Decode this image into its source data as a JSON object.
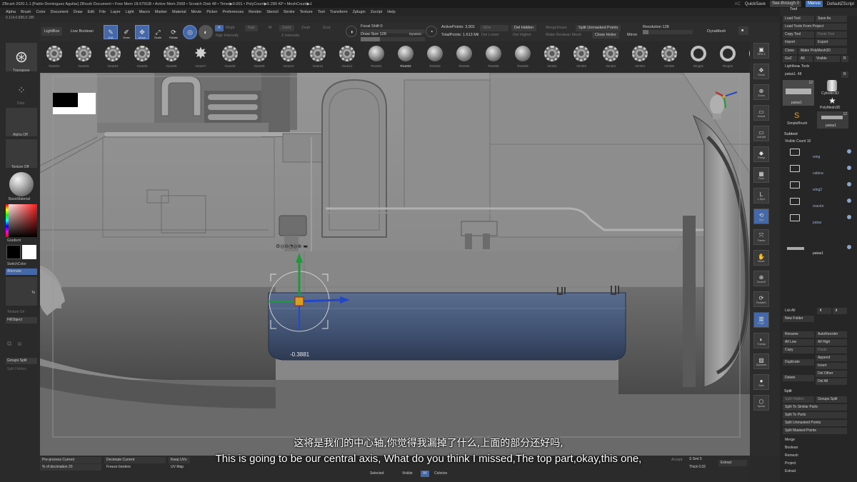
{
  "titlebar": {
    "text": "ZBrush 2020.1.1 [Pablo Dominguez Aguilar]   ZBrush Document     • Free Mem 18.675GB • Active Mem 2568 • Scratch Disk 48 •  Timer▶0.001 • PolyCount▶5.289 KP • MeshCount▶1",
    "ac": "AC",
    "quicksave": "QuickSave",
    "see_through": "See-through  0",
    "menus": "Menus",
    "script": "DefaultZScript"
  },
  "menubar": [
    "Alpha",
    "Brush",
    "Color",
    "Document",
    "Draw",
    "Edit",
    "File",
    "Layer",
    "Light",
    "Macro",
    "Marker",
    "Material",
    "Movie",
    "Picker",
    "Preferences",
    "Render",
    "Stencil",
    "Stroke",
    "Texture",
    "Tool",
    "Transform",
    "Zplugin",
    "Zscript",
    "Help"
  ],
  "coords": "0.114,0.836,0.185",
  "topbar": {
    "lightbox": "LightBox",
    "live_boolean": "Live Boolean",
    "edit": "Edit",
    "draw": "Draw",
    "move": "Move",
    "scale": "Scale",
    "rotate": "Rotate",
    "a": "A",
    "mrgb": "Mrgb",
    "rgb": "Rgb",
    "m": "M",
    "zadd": "Zadd",
    "zsub": "Zsub",
    "zcut": "Zcut",
    "rgb_intensity": "Rgb Intensity",
    "z_intensity": "Z Intensity",
    "focal_shift": "Focal Shift 0",
    "draw_size": "Draw Size 128",
    "dynamic": "Dynamic",
    "s": "S",
    "d": "D",
    "active_points": "ActivePoints: 3,901",
    "total_points": "TotalPoints: 1.613 Mil",
    "sdiv": "SDiv",
    "del_lower": "Del Lower",
    "del_hidden": "Del Hidden",
    "del_higher": "Del Higher",
    "merge_down": "MergeDown",
    "make_boolean_mesh": "Make Boolean Mesh",
    "split_unmasked": "Split Unmasked Points",
    "close_holes": "Close Holes",
    "mirror": "Mirror",
    "resolution": "Resolution 128",
    "dynamesh": "DynaMesh"
  },
  "brushes": [
    {
      "name": "Rivet01",
      "shape": "gear"
    },
    {
      "name": "Gear03",
      "shape": "gear"
    },
    {
      "name": "Gear04",
      "shape": "gear"
    },
    {
      "name": "Gear05",
      "shape": "gear"
    },
    {
      "name": "Gear06",
      "shape": "gear"
    },
    {
      "name": "Gear07",
      "shape": "star"
    },
    {
      "name": "Gear08",
      "shape": "gear"
    },
    {
      "name": "Gear09",
      "shape": "gear"
    },
    {
      "name": "Gear10",
      "shape": "gear"
    },
    {
      "name": "Gear11",
      "shape": "gear"
    },
    {
      "name": "Gear12",
      "shape": "gear"
    },
    {
      "name": "Rivet01",
      "shape": "ball"
    },
    {
      "name": "Rivet02",
      "shape": "ball",
      "selected": true
    },
    {
      "name": "Rivet03",
      "shape": "ball"
    },
    {
      "name": "Rivet04",
      "shape": "ball"
    },
    {
      "name": "Rivet05",
      "shape": "ball"
    },
    {
      "name": "Rivet06",
      "shape": "ball"
    },
    {
      "name": "Vent01",
      "shape": "gear"
    },
    {
      "name": "Vent02",
      "shape": "gear"
    },
    {
      "name": "Vent03",
      "shape": "gear"
    },
    {
      "name": "Vent04",
      "shape": "gear"
    },
    {
      "name": "Vent05",
      "shape": "gear"
    },
    {
      "name": "Ring01",
      "shape": "ring"
    },
    {
      "name": "Ring02",
      "shape": "ring"
    },
    {
      "name": "Ring03",
      "shape": "ring"
    }
  ],
  "leftpanel": {
    "transpose": "Transpose",
    "dots": "Dots",
    "alpha_off": "Alpha Off",
    "texture_off": "Texture Off",
    "basic_material": "BasicMaterial",
    "gradient": "Gradient",
    "switch_color": "SwitchColor",
    "alternate": "Alternate",
    "te": "Te",
    "texture_on": "Texture On",
    "fill_object": "FillObject",
    "groups_split": "Groups Split",
    "split_hidden": "Split Hidden"
  },
  "viewport": {
    "gizmo_value": "-0.3881"
  },
  "righttools": [
    {
      "icon": "▣",
      "label": "SPix 3"
    },
    {
      "icon": "✥",
      "label": "Scroll"
    },
    {
      "icon": "⊕",
      "label": "Zoom"
    },
    {
      "icon": "▭",
      "label": "Actual"
    },
    {
      "icon": "▭",
      "label": "AAHalf"
    },
    {
      "icon": "◆",
      "label": "Persp"
    },
    {
      "icon": "▦",
      "label": "Floor"
    },
    {
      "icon": "L",
      "label": "L.Sym"
    },
    {
      "icon": "⟲",
      "label": "Xyz",
      "active": true
    },
    {
      "icon": "⤧",
      "label": "Frame"
    },
    {
      "icon": "✋",
      "label": "Move"
    },
    {
      "icon": "⊕",
      "label": "ZoomD"
    },
    {
      "icon": "⟳",
      "label": "RotateD"
    },
    {
      "icon": "▥",
      "label": "PolyF",
      "active": true
    },
    {
      "icon": "◐",
      "label": "Transp"
    },
    {
      "icon": "▨",
      "label": "Dynamic"
    },
    {
      "icon": "●",
      "label": "Solo"
    },
    {
      "icon": "⬡",
      "label": "Xpose"
    }
  ],
  "rightpanel": {
    "tool_header": "Tool",
    "load_tool": "Load Tool",
    "save_as": "Save As",
    "load_tools_from_project": "Load Tools From Project",
    "copy_tool": "Copy Tool",
    "paste_tool": "Paste Tool",
    "import": "Import",
    "export": "Export",
    "clone": "Clone",
    "make_polymesh": "Make PolyMesh3D",
    "goz": "GoZ",
    "all": "All",
    "visible": "Visible",
    "r": "R",
    "lightbox_tools": "Lightbox▸ Tools",
    "current_tool": "patas1. 48",
    "r2": "R",
    "thumb_count_1": "12",
    "thumb_count_2": "12",
    "cylinder3d": "Cylinder3D",
    "patas1_thumb": "patas1",
    "polymesh3d": "PolyMesh3D",
    "simplebrush": "SimpleBrush",
    "patas1_thumb2": "patas1",
    "subtool_header": "Subtool",
    "visible_count": "Visible Count 10",
    "subtools": [
      "wing",
      "cabina",
      "wing2",
      "reactor",
      "patas"
    ],
    "patas1_row": "patas1",
    "list_all": "List All",
    "new_folder": "New Folder",
    "rename": "Rename",
    "auto_reorder": "AutoReorder",
    "all_low": "All Low",
    "all_high": "All High",
    "copy": "Copy",
    "paste": "Paste",
    "append": "Append",
    "duplicate": "Duplicate",
    "insert": "Insert",
    "del_other": "Del Other",
    "delete": "Delete",
    "del_all": "Del All",
    "split_header": "Split",
    "split_hidden": "Split Hidden",
    "groups_split": "Groups Split",
    "split_similar": "Split To Similar Parts",
    "split_parts": "Split To Parts",
    "split_unmasked": "Split Unmasked Points",
    "split_masked": "Split Masked Points",
    "merge": "Merge",
    "boolean": "Boolean",
    "remesh": "Remesh",
    "project": "Project",
    "extract": "Extract"
  },
  "bottombar": {
    "preprocess": "Pre-process Current",
    "decimate": "Decimate Current",
    "keep_uvs": "Keep UVs",
    "pct_decimation": "% of decimation 20",
    "freeze_borders": "Freeze borders",
    "uv_map": "UV Map",
    "selected": "Selected",
    "visible": "Visible",
    "all": "All",
    "colorize": "Colorize",
    "accept": "Accept",
    "s_smt": "S Smt 5",
    "thick": "Thick 0.02",
    "extract": "Extract"
  },
  "subtitles": {
    "chinese": "这将是我们的中心轴,你觉得我漏掉了什么,上面的部分还好吗,",
    "english": "This is going to be our central axis, What do you think I missed,The top part,okay,this one,"
  },
  "colors": {
    "accent": "#4468a8",
    "viewport_bg": "#7f7f7f",
    "selected_mesh": "#4b5f82"
  }
}
